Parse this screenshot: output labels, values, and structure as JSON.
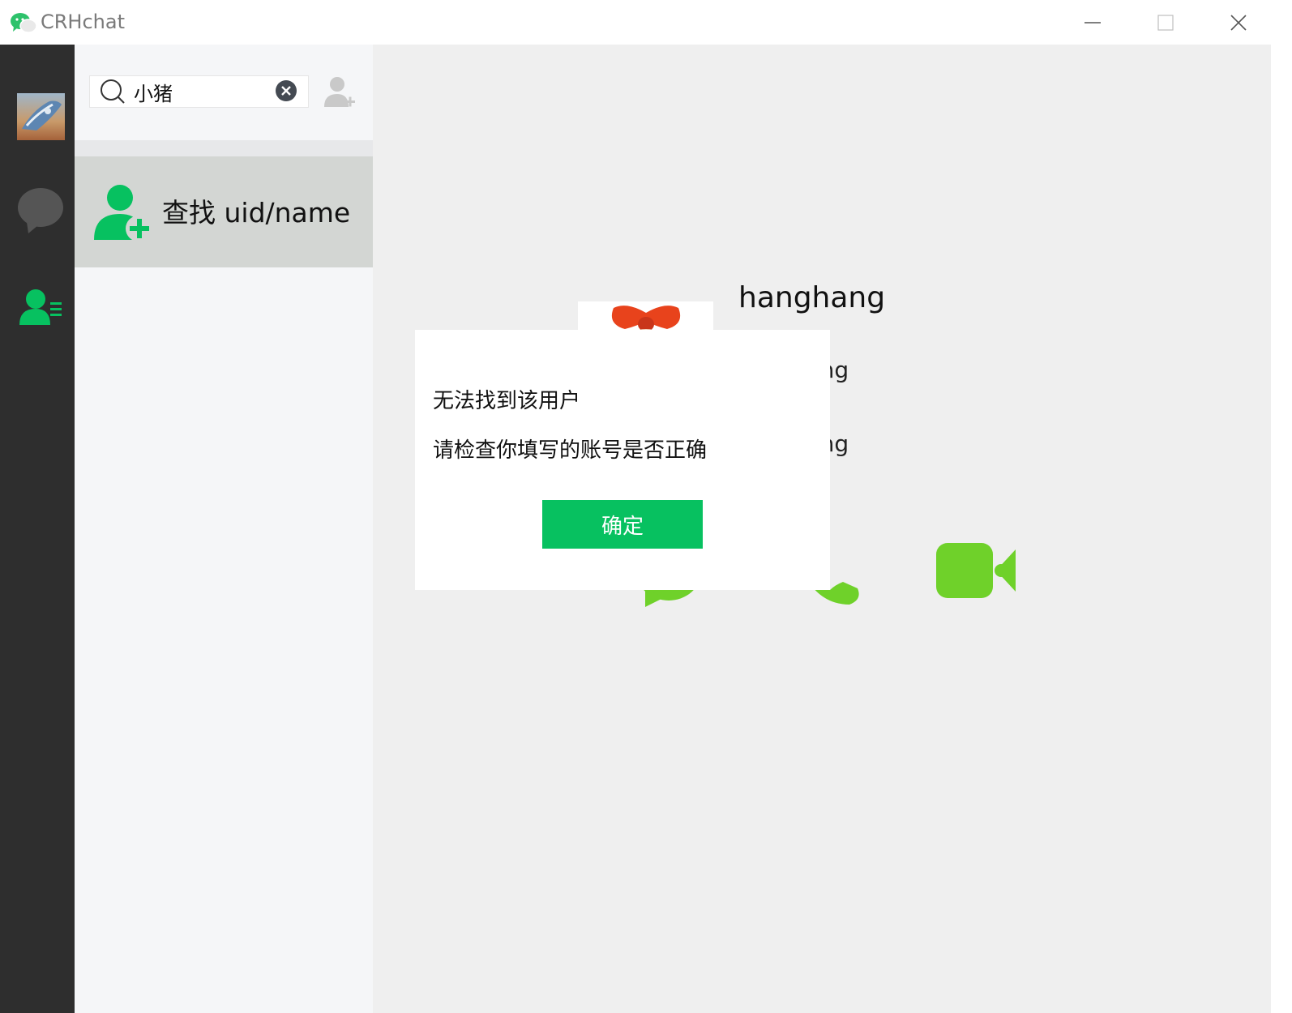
{
  "window": {
    "title": "CRHchat"
  },
  "search": {
    "value": "小猪",
    "placeholder": ""
  },
  "find_item": {
    "label": "查找 uid/name"
  },
  "profile": {
    "name": "hanghang",
    "uid_partial": "anghang",
    "nickname_partial": "anghang"
  },
  "dialog": {
    "title": "无法找到该用户",
    "message": "请检查你填写的账号是否正确",
    "ok_label": "确定"
  },
  "colors": {
    "accent": "#07c160",
    "action_green": "#6fd12a",
    "nav_bg": "#2e2e2e",
    "list_bg": "#f5f6f8",
    "selected_bg": "#d3d6d3",
    "main_bg": "#efefef"
  },
  "icons": {
    "app": "wechat-logo-icon",
    "search": "search-icon",
    "clear": "clear-circle-icon",
    "add_contact": "add-contact-icon",
    "find": "find-user-icon",
    "nav_chat": "chat-bubble-icon",
    "nav_contacts": "contacts-icon",
    "action_chat": "message-icon",
    "action_voice": "voice-call-icon",
    "action_video": "video-call-icon"
  }
}
